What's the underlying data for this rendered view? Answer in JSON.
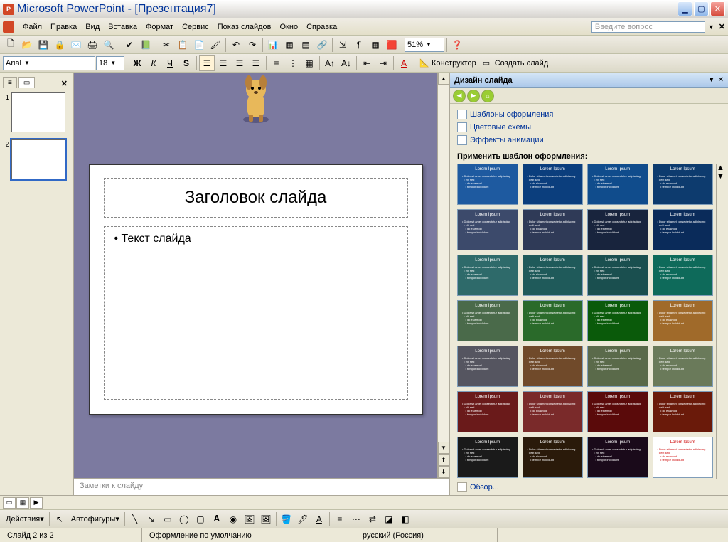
{
  "title": "Microsoft PowerPoint - [Презентация7]",
  "menus": [
    "Файл",
    "Правка",
    "Вид",
    "Вставка",
    "Формат",
    "Сервис",
    "Показ слайдов",
    "Окно",
    "Справка"
  ],
  "help_placeholder": "Введите вопрос",
  "font": {
    "name": "Arial",
    "size": "18"
  },
  "zoom": "51%",
  "designer_label": "Конструктор",
  "new_slide_label": "Создать слайд",
  "slide_tabs": {
    "outline_icon": "≡",
    "slides_icon": "▭"
  },
  "thumbs": [
    "1",
    "2"
  ],
  "slide": {
    "title": "Заголовок слайда",
    "body": "Текст слайда"
  },
  "notes_placeholder": "Заметки к слайду",
  "taskpane": {
    "title": "Дизайн слайда",
    "links": [
      "Шаблоны оформления",
      "Цветовые схемы",
      "Эффекты анимации"
    ],
    "apply_label": "Применить шаблон оформления:",
    "browse": "Обзор...",
    "templates": [
      {
        "bg": "#1e5aa0"
      },
      {
        "bg": "#0b3e7d"
      },
      {
        "bg": "#104c8c"
      },
      {
        "bg": "#0d3b6e"
      },
      {
        "bg": "#3c4a6b"
      },
      {
        "bg": "#2f3a57"
      },
      {
        "bg": "#18243d"
      },
      {
        "bg": "#0a2b5a"
      },
      {
        "bg": "#2e6a6a"
      },
      {
        "bg": "#1f5a5a"
      },
      {
        "bg": "#1a4f4f"
      },
      {
        "bg": "#0e6a5a"
      },
      {
        "bg": "#4a6a4a"
      },
      {
        "bg": "#2a6a2a"
      },
      {
        "bg": "#0a5a0a"
      },
      {
        "bg": "#a06a2a"
      },
      {
        "bg": "#555560"
      },
      {
        "bg": "#704a2a"
      },
      {
        "bg": "#5a6a4a"
      },
      {
        "bg": "#6a7a5a"
      },
      {
        "bg": "#6a1a1a"
      },
      {
        "bg": "#7a2a2a"
      },
      {
        "bg": "#5a0a0a"
      },
      {
        "bg": "#6a1a0a"
      },
      {
        "bg": "#1a1a1a"
      },
      {
        "bg": "#2a1a0a"
      },
      {
        "bg": "#1a0a1a"
      },
      {
        "bg": "#ffffff",
        "fg": "#c00"
      },
      {
        "bg": "#3a3a6a"
      },
      {
        "bg": "#1a3a6a"
      },
      {
        "bg": "#2a4a7a"
      },
      {
        "bg": "#2a5a8a"
      }
    ]
  },
  "drawbar": {
    "actions": "Действия",
    "autoshapes": "Автофигуры"
  },
  "status": {
    "slide": "Слайд 2 из 2",
    "design": "Оформление по умолчанию",
    "lang": "русский (Россия)"
  }
}
